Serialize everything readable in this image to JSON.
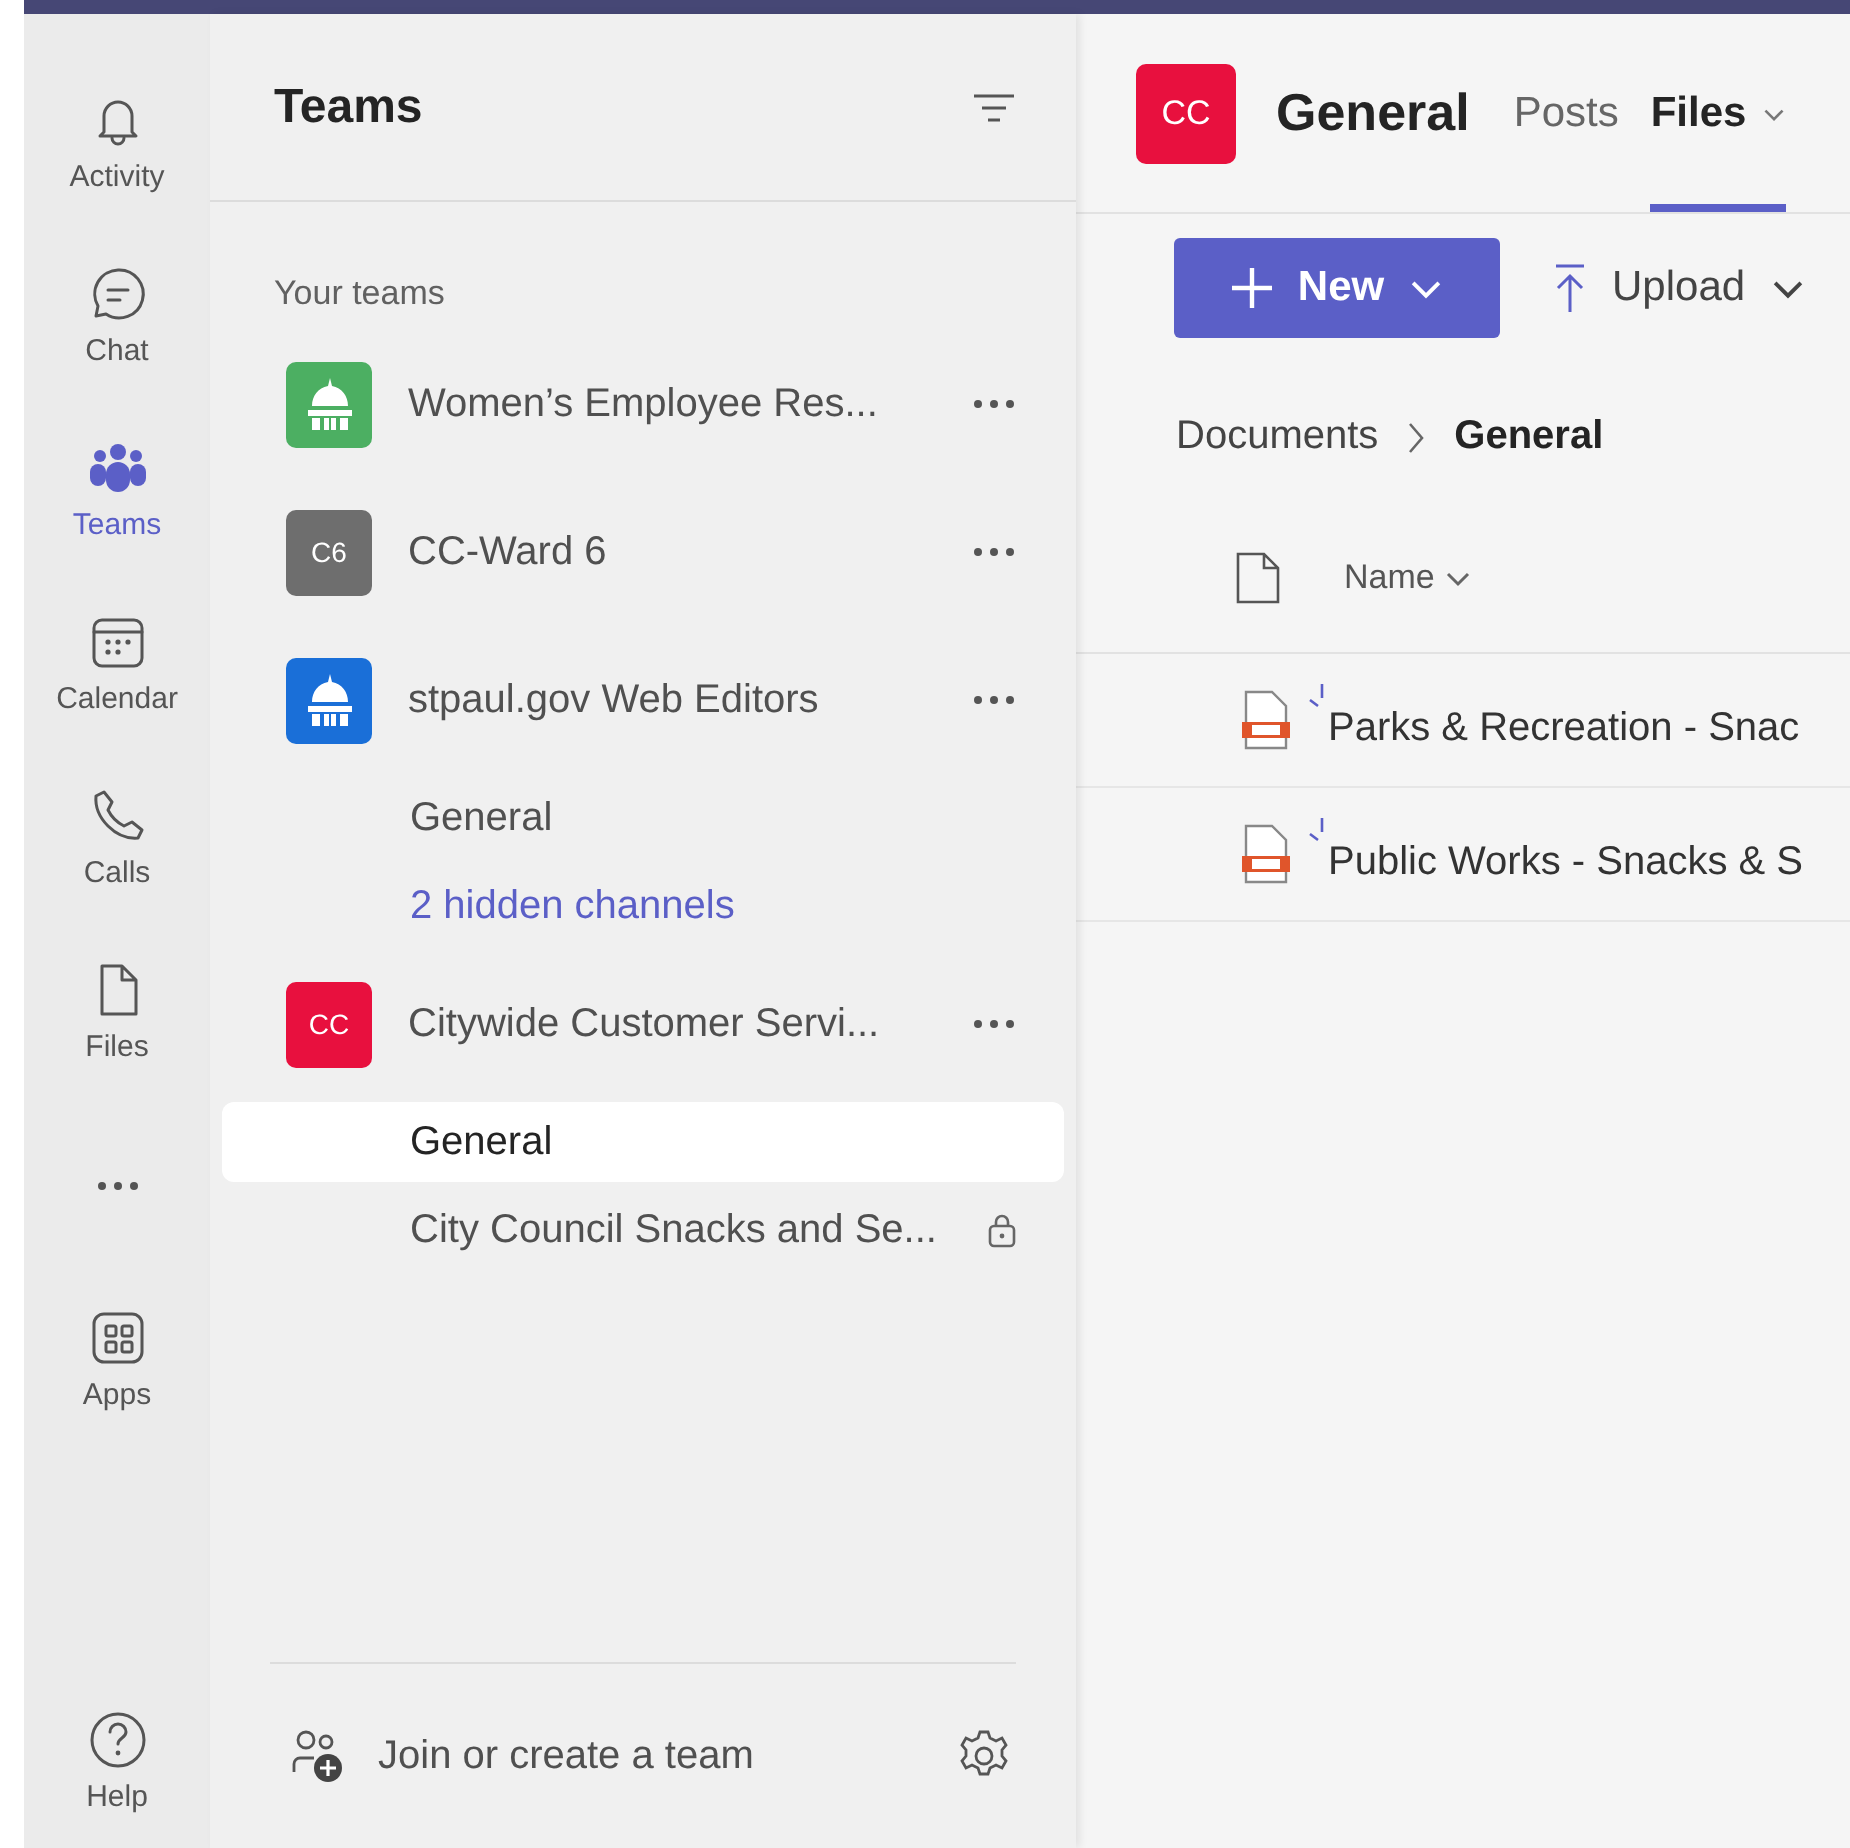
{
  "rail": [
    {
      "label": "Activity",
      "selected": false
    },
    {
      "label": "Chat",
      "selected": false
    },
    {
      "label": "Teams",
      "selected": true
    },
    {
      "label": "Calendar",
      "selected": false
    },
    {
      "label": "Calls",
      "selected": false
    },
    {
      "label": "Files",
      "selected": false
    },
    {
      "selected": false
    },
    {
      "label": "Apps",
      "selected": false
    }
  ],
  "help": {
    "label": "Help"
  },
  "teams_panel": {
    "title": "Teams",
    "section": "Your teams",
    "teams": [
      {
        "name": "Women’s Employee Res...",
        "avatar": {
          "kind": "building",
          "color": "#4caf62"
        }
      },
      {
        "name": "CC-Ward 6",
        "avatar": {
          "kind": "initials",
          "text": "C6",
          "color": "#6e6e6e"
        }
      },
      {
        "name": "stpaul.gov Web Editors",
        "avatar": {
          "kind": "building",
          "color": "#1a6fd8"
        },
        "channels": [
          {
            "name": "General",
            "kind": "channel",
            "selected": false,
            "private": false
          },
          {
            "name": "2 hidden channels",
            "kind": "link",
            "selected": false,
            "private": false
          }
        ]
      },
      {
        "name": "Citywide Customer Servi...",
        "avatar": {
          "kind": "initials",
          "text": "CC",
          "color": "#e8103e"
        },
        "channels": [
          {
            "name": "General",
            "kind": "channel",
            "selected": true,
            "private": false
          },
          {
            "name": "City Council Snacks and Se...",
            "kind": "channel",
            "selected": false,
            "private": true
          }
        ]
      }
    ],
    "footer": "Join or create a team"
  },
  "main": {
    "avatar": "CC",
    "title": "General",
    "tabs": [
      {
        "label": "Posts",
        "selected": false,
        "dropdown": false
      },
      {
        "label": "Files",
        "selected": true,
        "dropdown": true
      }
    ],
    "new_button": "New",
    "upload_button": "Upload",
    "breadcrumb": [
      "Documents",
      "General"
    ],
    "column": "Name",
    "files": [
      "Parks & Recreation - Snac",
      "Public Works - Snacks & S"
    ]
  }
}
